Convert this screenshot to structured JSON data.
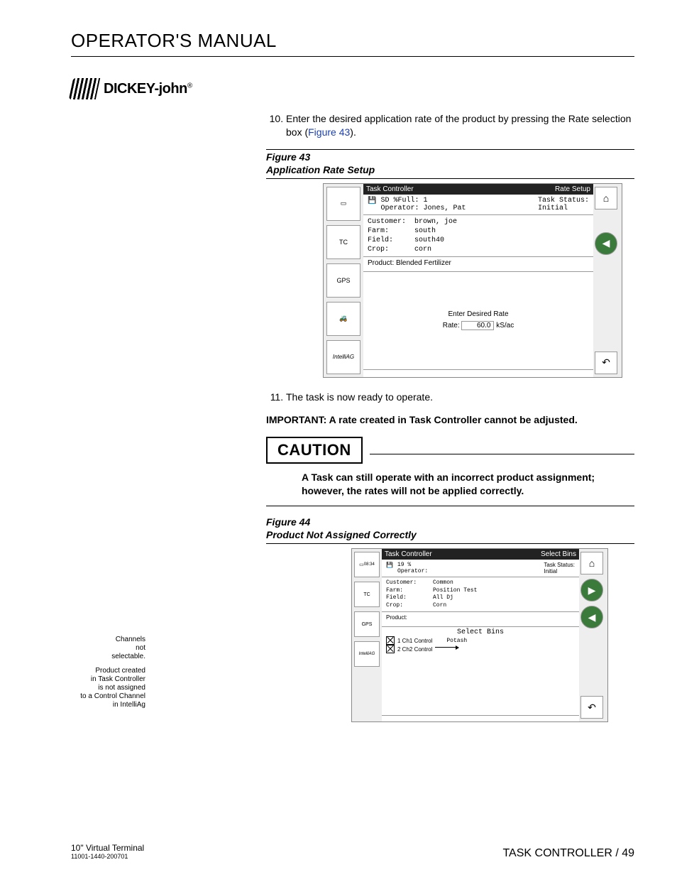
{
  "header": {
    "title": "OPERATOR'S MANUAL"
  },
  "logo": {
    "text": "DICKEY-john",
    "reg": "®"
  },
  "steps": {
    "ten": {
      "num": "10.",
      "text_a": "Enter the desired application rate of the product by pressing the Rate selection box (",
      "link": "Figure 43",
      "text_b": ")."
    },
    "eleven": {
      "num": "11.",
      "text": "The task is now ready to operate."
    }
  },
  "fig43": {
    "label": "Figure 43",
    "caption": "Application Rate Setup",
    "title_left": "Task Controller",
    "title_right": "Rate Setup",
    "sd_full": "SD %Full:   1",
    "operator_line": "Operator: Jones, Pat",
    "task_status_label": "Task Status:",
    "task_status_value": "Initial",
    "customer_l": "Customer:",
    "customer_v": "brown, joe",
    "farm_l": "Farm:",
    "farm_v": "south",
    "field_l": "Field:",
    "field_v": "south40",
    "crop_l": "Crop:",
    "crop_v": "corn",
    "product_line": "Product: Blended Fertilizer",
    "enter_rate": "Enter Desired Rate",
    "rate_label": "Rate:",
    "rate_value": "60.0",
    "rate_unit": "kS/ac",
    "side_labels": {
      "s1": "",
      "s2": "TC",
      "s3": "GPS",
      "s4": "",
      "s5": "IntelliAG"
    }
  },
  "important": {
    "label": "IMPORTANT:",
    "text": "A rate created in Task Controller cannot be adjusted."
  },
  "caution": {
    "word": "CAUTION",
    "text": "A Task can still operate with an incorrect product assignment; however, the rates will not be applied correctly."
  },
  "fig44": {
    "label": "Figure 44",
    "caption": "Product Not Assigned Correctly",
    "title_left": "Task Controller",
    "title_right": "Select Bins",
    "time": "08:34",
    "pct": "19 %",
    "operator_line": "Operator:",
    "task_status_label": "Task Status:",
    "task_status_value": "Initial",
    "customer_l": "Customer:",
    "customer_v": "Common",
    "farm_l": "Farm:",
    "farm_v": "Position Test",
    "field_l": "Field:",
    "field_v": "All Dj",
    "crop_l": "Crop:",
    "crop_v": "Corn",
    "product_line": "Product:",
    "select_bins": "Select Bins",
    "ch1": "1 Ch1 Control",
    "ch1_val": "Potash",
    "ch2": "2 Ch2 Control",
    "annot1": "Channels\nnot\nselectable.",
    "annot2": "Product created\nin Task Controller\nis not assigned\nto a Control Channel\nin IntelliAg"
  },
  "footer": {
    "left1": "10\" Virtual Terminal",
    "left2": "11001-1440-200701",
    "right": "TASK CONTROLLER / 49"
  }
}
